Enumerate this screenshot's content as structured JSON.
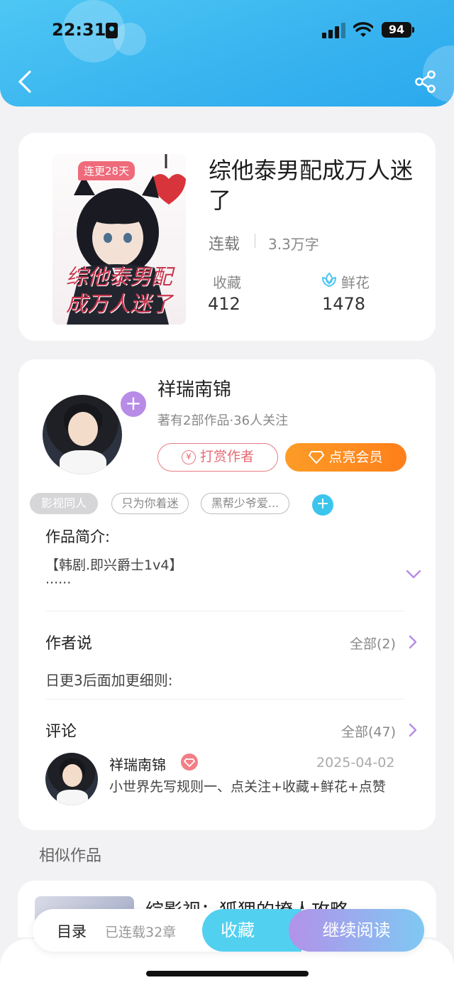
{
  "status_bar": {
    "time": "22:31",
    "battery": "94"
  },
  "book": {
    "cover_badge": "连更28天",
    "cover_title_line1": "综他泰男配",
    "cover_title_line2": "成万人迷了",
    "title": "综他泰男配成万人迷了",
    "status": "连载",
    "words": "3.3万字",
    "favorites_label": "收藏",
    "favorites_value": "412",
    "flowers_label": "鲜花",
    "flowers_value": "1478"
  },
  "author": {
    "name": "祥瑞南锦",
    "meta": "著有2部作品·36人关注",
    "reward_label": "打赏作者",
    "reward_icon_char": "¥",
    "vip_label": "点亮会员"
  },
  "tags": [
    "影视同人",
    "只为你着迷",
    "黑帮少爷爱..."
  ],
  "intro": {
    "heading": "作品简介:",
    "text": "【韩剧.即兴爵士1v4】",
    "more": "······"
  },
  "author_note": {
    "heading": "作者说",
    "all_label": "全部(2)",
    "text": "日更3后面加更细则:"
  },
  "comments": {
    "heading": "评论",
    "all_label": "全部(47)",
    "items": [
      {
        "name": "祥瑞南锦",
        "date": "2025-04-02",
        "text": "小世界先写规则一、点关注+收藏+鲜花+点赞"
      }
    ]
  },
  "similar": {
    "heading": "相似作品",
    "first_title": "综影视：狐狸的撩人攻略"
  },
  "bottom_bar": {
    "toc_label": "目录",
    "progress": "已连载32章",
    "favorite_label": "收藏",
    "read_label": "继续阅读"
  },
  "colors": {
    "header": "#39b4ef",
    "accent_purple": "#b78be6",
    "reward": "#e56a73",
    "vip": "#fe8a1f"
  }
}
